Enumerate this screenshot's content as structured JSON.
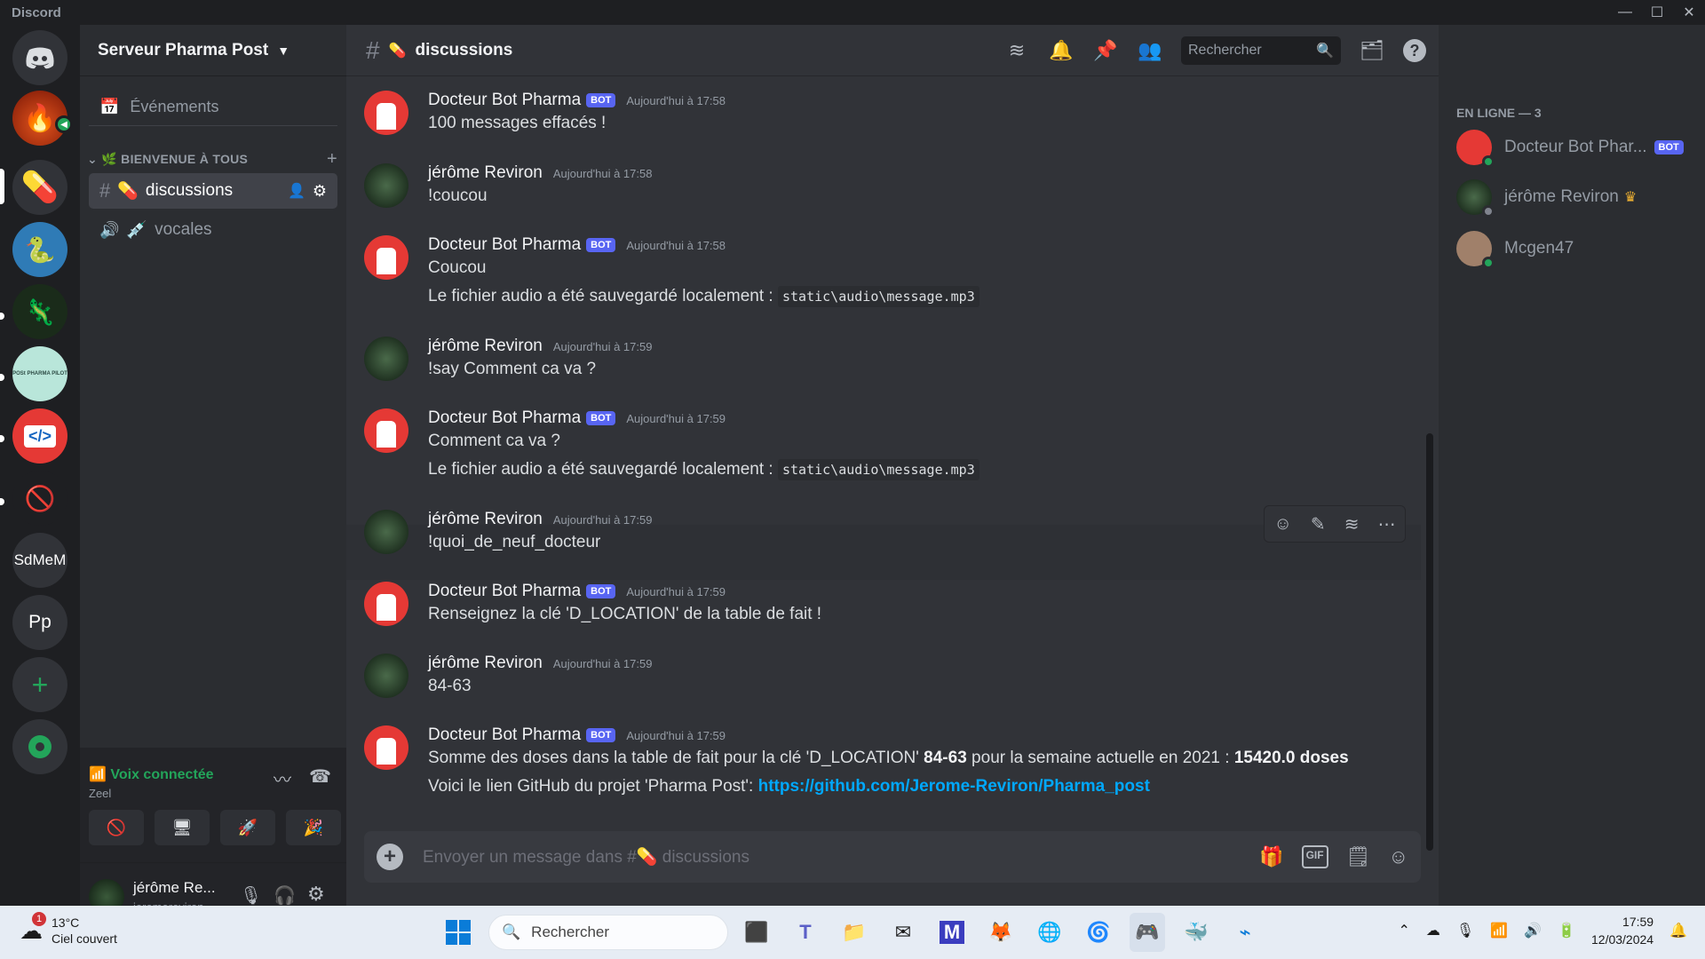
{
  "app": {
    "title": "Discord"
  },
  "window_controls": {
    "minimize": "—",
    "maximize": "☐",
    "close": "✕"
  },
  "servers": [
    {
      "name": "Home",
      "icon": "discord-icon"
    },
    {
      "name": "Campfire",
      "icon": "campfire-icon"
    },
    {
      "name": "Serveur Pharma Post",
      "icon": "pills-icon",
      "active": true
    },
    {
      "name": "Python",
      "icon": "python-icon"
    },
    {
      "name": "Chameleon",
      "icon": "chameleon-icon"
    },
    {
      "name": "POSt PHARMA PILOT",
      "icon": "pharma-pilot-icon"
    },
    {
      "name": "Code",
      "icon": "code-icon"
    },
    {
      "name": "Server",
      "icon": "server-icon"
    },
    {
      "name": "SdMeM",
      "label": "SdMeM"
    },
    {
      "name": "Pp",
      "label": "Pp"
    },
    {
      "name": "add-server",
      "label": "+"
    },
    {
      "name": "discover",
      "icon": "compass-icon"
    }
  ],
  "server": {
    "name": "Serveur Pharma Post"
  },
  "sidebar": {
    "events_label": "Événements",
    "category": "BIENVENUE À TOUS",
    "channels": [
      {
        "type": "text",
        "emoji": "💊",
        "name": "discussions",
        "active": true
      },
      {
        "type": "voice",
        "emoji": "💉",
        "name": "vocales"
      }
    ]
  },
  "voice": {
    "status": "Voix connectée",
    "channel": "Zeel"
  },
  "user": {
    "display_name": "jérôme Re...",
    "username": "jeromereviron"
  },
  "chat": {
    "channel_emoji": "💊",
    "channel_name": "discussions",
    "search_placeholder": "Rechercher",
    "composer_placeholder": "Envoyer un message dans #💊 discussions"
  },
  "messages": [
    {
      "author": "Docteur Bot Pharma",
      "bot": true,
      "badge": "BOT",
      "time": "Aujourd'hui à 17:58",
      "lines": [
        "100 messages effacés !"
      ]
    },
    {
      "author": "jérôme Reviron",
      "bot": false,
      "time": "Aujourd'hui à 17:58",
      "lines": [
        "!coucou"
      ]
    },
    {
      "author": "Docteur Bot Pharma",
      "bot": true,
      "badge": "BOT",
      "time": "Aujourd'hui à 17:58",
      "lines": [
        "Coucou",
        "Le fichier audio a été sauvegardé localement :"
      ],
      "code": "static\\audio\\message.mp3"
    },
    {
      "author": "jérôme Reviron",
      "bot": false,
      "time": "Aujourd'hui à 17:59",
      "lines": [
        "!say Comment ca va ?"
      ]
    },
    {
      "author": "Docteur Bot Pharma",
      "bot": true,
      "badge": "BOT",
      "time": "Aujourd'hui à 17:59",
      "lines": [
        "Comment ca va ?",
        "Le fichier audio a été sauvegardé localement :"
      ],
      "code": "static\\audio\\message.mp3"
    },
    {
      "author": "jérôme Reviron",
      "bot": false,
      "time": "Aujourd'hui à 17:59",
      "lines": [
        "!quoi_de_neuf_docteur"
      ]
    },
    {
      "author": "Docteur Bot Pharma",
      "bot": true,
      "badge": "BOT",
      "time": "Aujourd'hui à 17:59",
      "lines": [
        "Renseignez la clé 'D_LOCATION' de la table de fait !"
      ]
    },
    {
      "author": "jérôme Reviron",
      "bot": false,
      "time": "Aujourd'hui à 17:59",
      "lines": [
        "84-63"
      ]
    },
    {
      "author": "Docteur Bot Pharma",
      "bot": true,
      "badge": "BOT",
      "time": "Aujourd'hui à 17:59",
      "sum_prefix": "Somme des doses dans la table de fait pour la clé 'D_LOCATION' ",
      "sum_key": "84-63",
      "sum_mid": " pour la semaine actuelle en 2021 : ",
      "sum_value": "15420.0 doses",
      "link_prefix": "Voici le lien GitHub du projet 'Pharma Post': ",
      "link": "https://github.com/Jerome-Reviron/Pharma_post"
    }
  ],
  "members": {
    "header": "EN LIGNE — 3",
    "list": [
      {
        "name": "Docteur Bot Phar...",
        "badge": "BOT",
        "status_color": "#23a55a"
      },
      {
        "name": "jérôme Reviron",
        "crown": "♛",
        "status_color": "#80848e"
      },
      {
        "name": "Mcgen47",
        "status_color": "#23a55a"
      }
    ]
  },
  "taskbar": {
    "weather_temp": "13°C",
    "weather_desc": "Ciel couvert",
    "weather_badge": "1",
    "search_label": "Rechercher",
    "time": "17:59",
    "date": "12/03/2024"
  },
  "colors": {
    "accent": "#5865f2",
    "link": "#00a8fc",
    "online": "#23a55a",
    "voice": "#23a55a"
  }
}
